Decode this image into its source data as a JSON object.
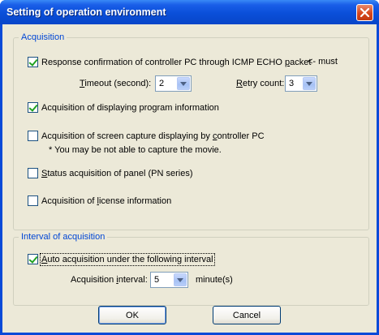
{
  "window": {
    "title": "Setting of operation environment",
    "close_icon": "close-icon"
  },
  "acquisition": {
    "legend": "Acquisition",
    "icmp": {
      "checked": true,
      "label_pre": "Response confirmation of controller PC through ICMP ECHO ",
      "label_key": "p",
      "label_post": "acket",
      "suffix": "<- must"
    },
    "timeout": {
      "label_key": "T",
      "label_post": "imeout (second):",
      "value": "2"
    },
    "retry": {
      "label_key": "R",
      "label_post": "etry count:",
      "value": "3"
    },
    "program_info": {
      "checked": true,
      "label_pre": "Acquisition of displaying pro",
      "label_key": "g",
      "label_post": "ram information"
    },
    "screen_capture": {
      "checked": false,
      "label_pre": "Acquisition of screen capture displaying by ",
      "label_key": "c",
      "label_post": "ontroller PC",
      "note": "* You may be not able to capture the movie."
    },
    "panel_status": {
      "checked": false,
      "label_key": "S",
      "label_post": "tatus acquisition of panel (PN series)"
    },
    "license_info": {
      "checked": false,
      "label_pre": "Acquisition of ",
      "label_key": "l",
      "label_post": "icense information"
    }
  },
  "interval": {
    "legend": "Interval of acquisition",
    "auto": {
      "checked": true,
      "label_key": "A",
      "label_post": "uto acquisition under the following interval"
    },
    "interval_field": {
      "label_pre": "Acquisition ",
      "label_key": "i",
      "label_post": "nterval:",
      "value": "5",
      "unit": "minute(s)"
    }
  },
  "buttons": {
    "ok": "OK",
    "cancel": "Cancel"
  },
  "colors": {
    "title_bar": "#0a4fd9",
    "dialog_face": "#ece9d8",
    "group_legend": "#0046d5",
    "checkmark": "#21a121",
    "close_button": "#d6461c"
  }
}
